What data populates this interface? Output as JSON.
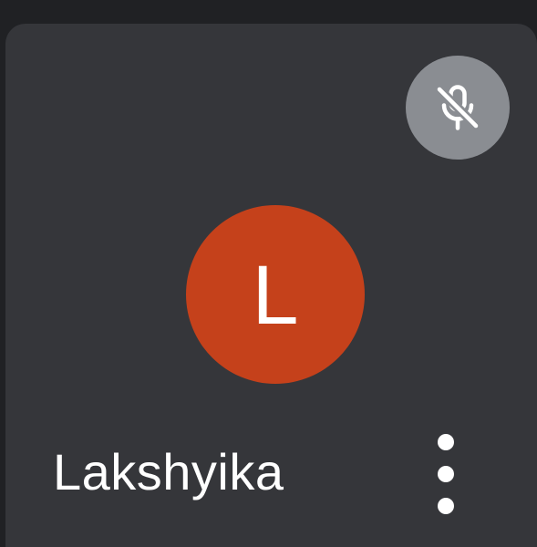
{
  "participant": {
    "name": "Lakshyika",
    "avatar_initial": "L",
    "avatar_color": "#c5411b",
    "mic_status_icon": "mic-off-icon",
    "more_options_icon": "more-vert-icon"
  },
  "colors": {
    "tile_background": "#35363a",
    "page_background": "#202124",
    "mic_badge_background": "#8a8d92"
  }
}
